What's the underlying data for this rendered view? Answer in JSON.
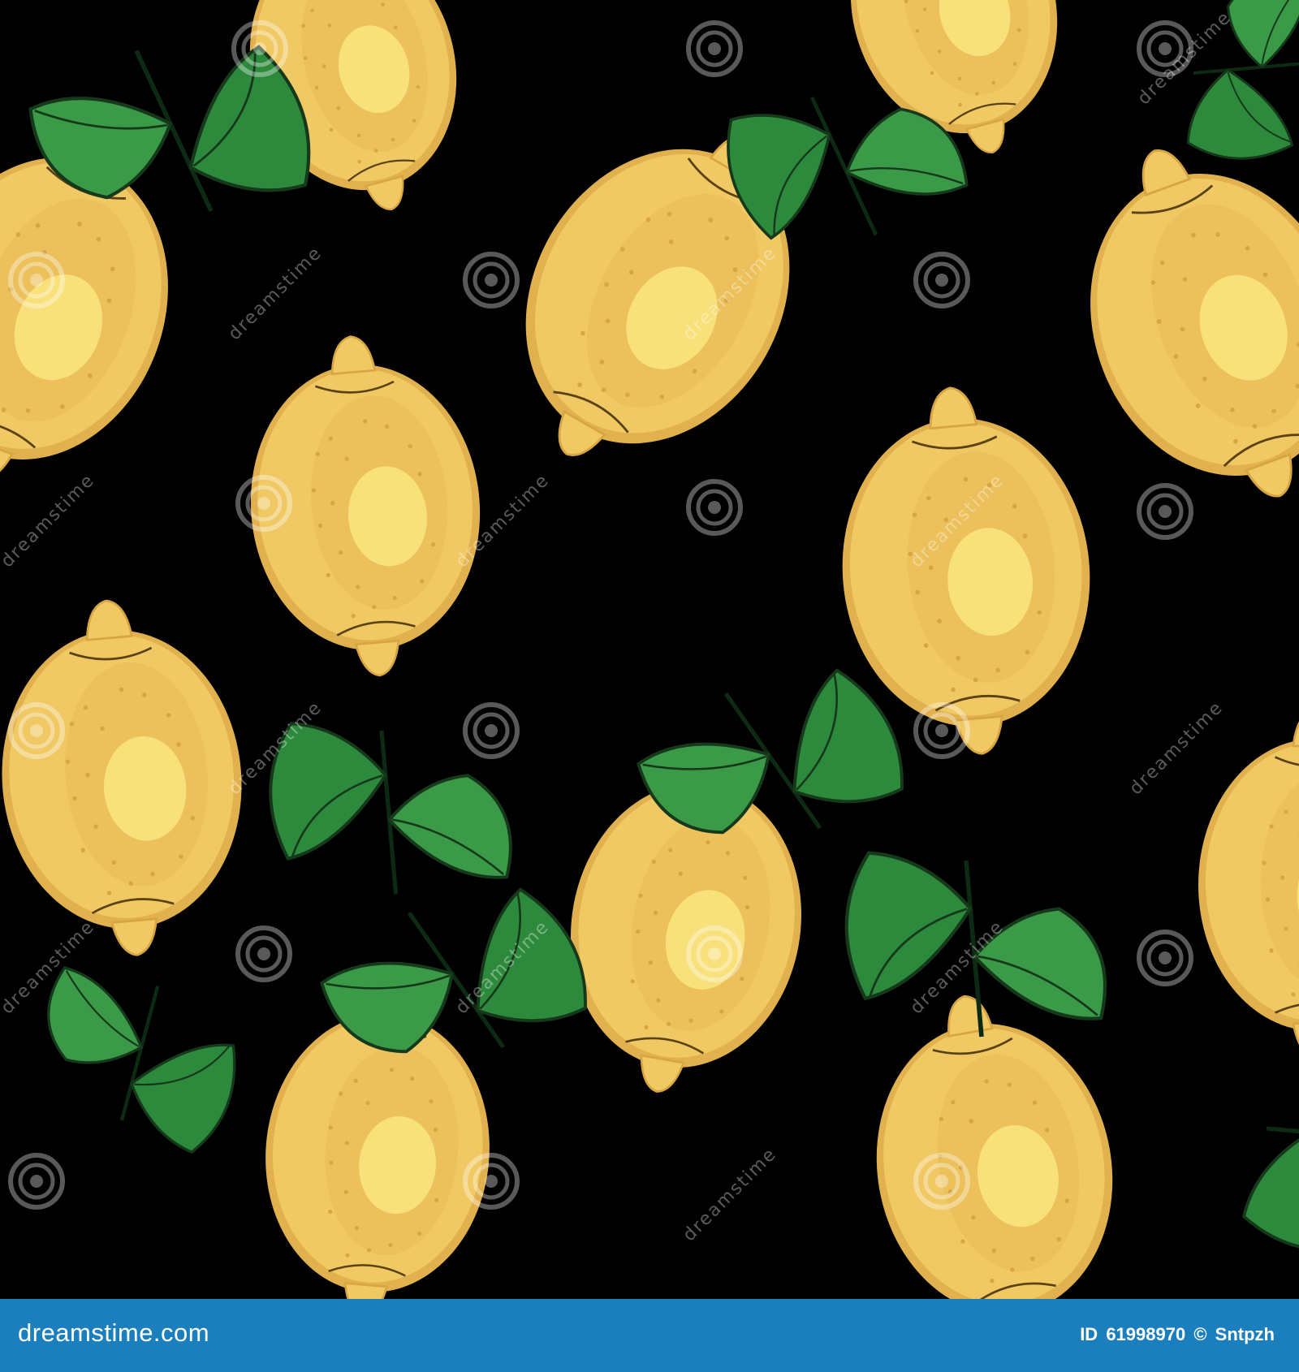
{
  "background": {
    "color": "#000000",
    "lemon_fill": "#f1c964",
    "lemon_shade": "#e0b14e",
    "lemon_highlight": "#f8e07a",
    "leaf_fill": "#2d8a3c",
    "leaf_vein": "#15391a"
  },
  "artwork": {
    "subject": "lemon-seamless-pattern",
    "lemon_count": 12
  },
  "watermark": {
    "text": "dreamstime",
    "icon": "spiral-logo-icon"
  },
  "footer": {
    "background_color": "#1b7fbd",
    "brand": "dreamstime.com",
    "id_label": "ID",
    "id_value": "61998970",
    "separator": "©",
    "author": "Sntpzh"
  }
}
